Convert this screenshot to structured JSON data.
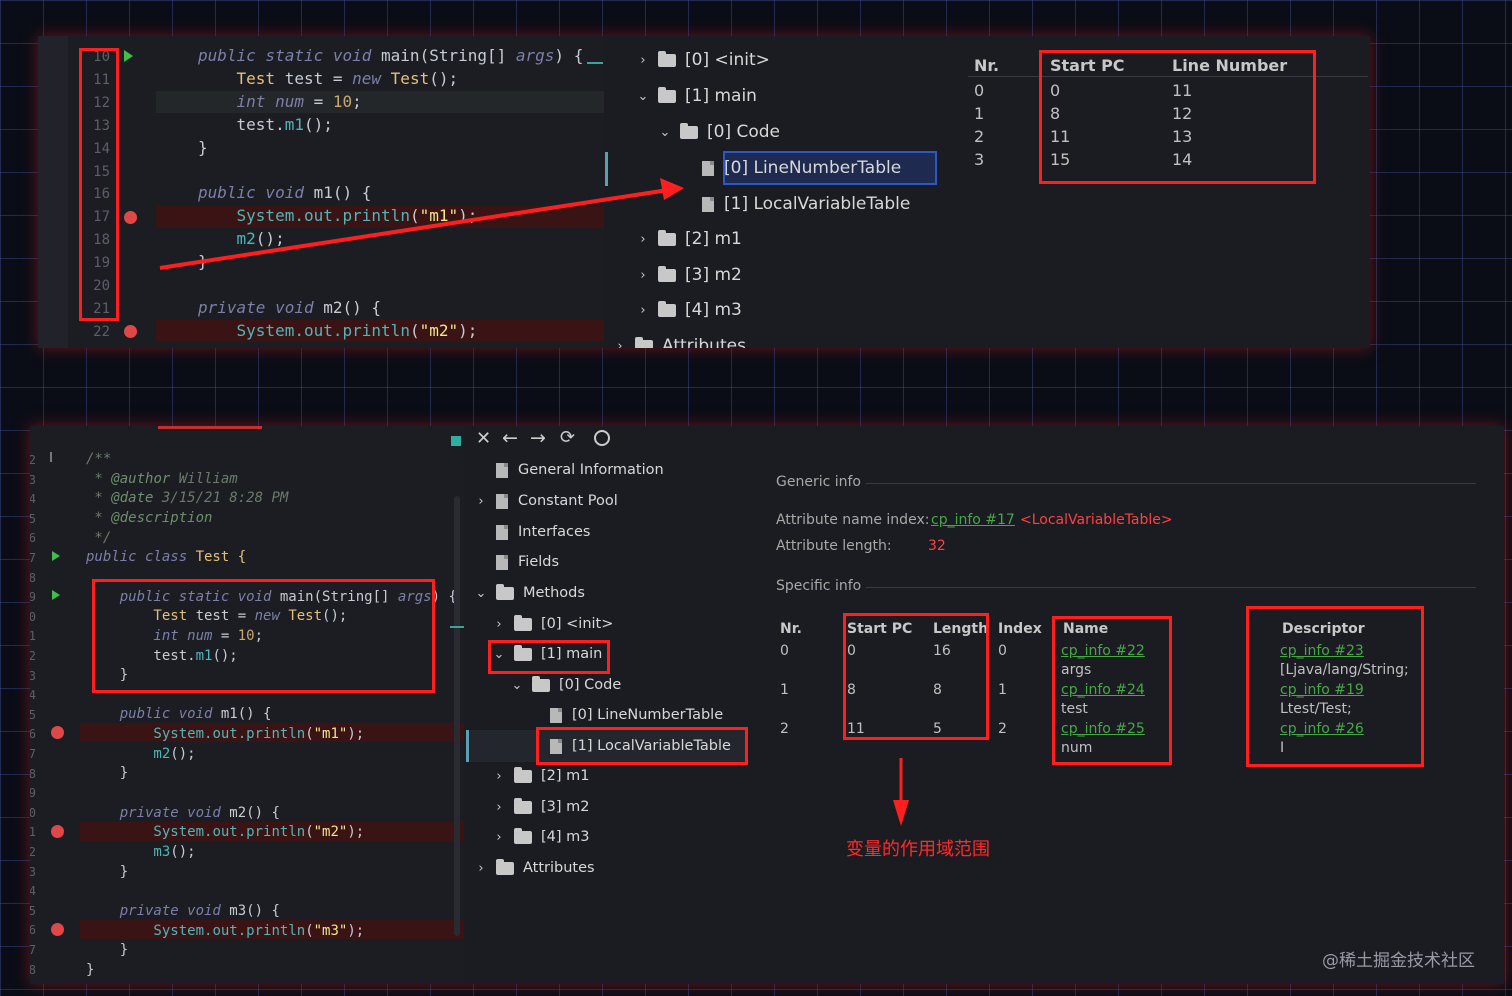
{
  "top_panel": {
    "gutter_lines": [
      "10",
      "11",
      "12",
      "13",
      "14",
      "15",
      "16",
      "17",
      "18",
      "19",
      "20",
      "21",
      "22"
    ],
    "code_lines": [
      {
        "parts": [
          {
            "t": "public static void ",
            "c": "kw"
          },
          {
            "t": "main",
            "c": "fn"
          },
          {
            "t": "(String[] ",
            "c": "fn"
          },
          {
            "t": "args",
            "c": "kw"
          },
          {
            "t": ") {",
            "c": "fn"
          }
        ]
      },
      {
        "parts": [
          {
            "t": "    Test ",
            "c": "cls"
          },
          {
            "t": "test ",
            "c": "fn"
          },
          {
            "t": "= ",
            "c": "fn"
          },
          {
            "t": "new ",
            "c": "kw"
          },
          {
            "t": "Test",
            "c": "cls"
          },
          {
            "t": "();",
            "c": "fn"
          }
        ]
      },
      {
        "parts": [
          {
            "t": "    int ",
            "c": "kw"
          },
          {
            "t": "num ",
            "c": "kw"
          },
          {
            "t": "= ",
            "c": "fn"
          },
          {
            "t": "10",
            "c": "num"
          },
          {
            "t": ";",
            "c": "fn"
          }
        ]
      },
      {
        "parts": [
          {
            "t": "    test.",
            "c": "fn"
          },
          {
            "t": "m1",
            "c": "field"
          },
          {
            "t": "();",
            "c": "fn"
          }
        ]
      },
      {
        "parts": [
          {
            "t": "}",
            "c": "fn"
          }
        ]
      },
      {
        "parts": []
      },
      {
        "parts": [
          {
            "t": "public void ",
            "c": "kw"
          },
          {
            "t": "m1() {",
            "c": "fn"
          }
        ]
      },
      {
        "parts": [
          {
            "t": "    System.",
            "c": "field"
          },
          {
            "t": "out",
            "c": "field"
          },
          {
            "t": ".",
            "c": "field"
          },
          {
            "t": "println",
            "c": "field"
          },
          {
            "t": "(",
            "c": "fn"
          },
          {
            "t": "\"m1\"",
            "c": "str"
          },
          {
            "t": ");",
            "c": "fn"
          }
        ]
      },
      {
        "parts": [
          {
            "t": "    m2",
            "c": "field"
          },
          {
            "t": "();",
            "c": "fn"
          }
        ]
      },
      {
        "parts": [
          {
            "t": "}",
            "c": "fn"
          }
        ]
      },
      {
        "parts": []
      },
      {
        "parts": [
          {
            "t": "private void ",
            "c": "kw"
          },
          {
            "t": "m2() {",
            "c": "fn"
          }
        ]
      },
      {
        "parts": [
          {
            "t": "    System.",
            "c": "field"
          },
          {
            "t": "out",
            "c": "field"
          },
          {
            "t": ".",
            "c": "field"
          },
          {
            "t": "println",
            "c": "field"
          },
          {
            "t": "(",
            "c": "fn"
          },
          {
            "t": "\"m2\"",
            "c": "str"
          },
          {
            "t": ");",
            "c": "fn"
          }
        ]
      }
    ],
    "tree": [
      {
        "label": "[0] <init>",
        "type": "folder",
        "arrow": "›"
      },
      {
        "label": "[1] main",
        "type": "folder",
        "arrow": "⌄"
      },
      {
        "label": "[0] Code",
        "type": "folder",
        "arrow": "⌄"
      },
      {
        "label": "[0] LineNumberTable",
        "type": "file",
        "arrow": ""
      },
      {
        "label": "[1] LocalVariableTable",
        "type": "file",
        "arrow": ""
      },
      {
        "label": "[2] m1",
        "type": "folder",
        "arrow": "›"
      },
      {
        "label": "[3] m2",
        "type": "folder",
        "arrow": "›"
      },
      {
        "label": "[4] m3",
        "type": "folder",
        "arrow": "›"
      },
      {
        "label": "Attributes",
        "type": "folder",
        "arrow": "›"
      }
    ],
    "table": {
      "headers": [
        "Nr.",
        "Start PC",
        "Line Number"
      ],
      "rows": [
        [
          "0",
          "0",
          "11"
        ],
        [
          "1",
          "8",
          "12"
        ],
        [
          "2",
          "11",
          "13"
        ],
        [
          "3",
          "15",
          "14"
        ]
      ]
    }
  },
  "bottom_panel": {
    "gutter_lines": [
      "2",
      "3",
      "4",
      "5",
      "6",
      "7",
      "8",
      "9",
      "0",
      "1",
      "2",
      "3",
      "4",
      "5",
      "6",
      "7",
      "8",
      "9",
      "0",
      "1",
      "2",
      "3",
      "4",
      "5",
      "6",
      "7",
      "8",
      "9"
    ],
    "code_lines": [
      {
        "parts": [
          {
            "t": "/**",
            "c": "cmt"
          }
        ]
      },
      {
        "parts": [
          {
            "t": " * ",
            "c": "cmt"
          },
          {
            "t": "@author ",
            "c": "tag"
          },
          {
            "t": "William",
            "c": "cmt"
          }
        ]
      },
      {
        "parts": [
          {
            "t": " * ",
            "c": "cmt"
          },
          {
            "t": "@date ",
            "c": "tag"
          },
          {
            "t": "3/15/21 8:28 PM",
            "c": "cmt"
          }
        ]
      },
      {
        "parts": [
          {
            "t": " * ",
            "c": "cmt"
          },
          {
            "t": "@description",
            "c": "tag"
          }
        ]
      },
      {
        "parts": [
          {
            "t": " */",
            "c": "cmt"
          }
        ]
      },
      {
        "parts": [
          {
            "t": "public class ",
            "c": "kw"
          },
          {
            "t": "Test {",
            "c": "cls"
          }
        ]
      },
      {
        "parts": []
      },
      {
        "parts": [
          {
            "t": "    public static void ",
            "c": "kw"
          },
          {
            "t": "main",
            "c": "fn"
          },
          {
            "t": "(String[] ",
            "c": "fn"
          },
          {
            "t": "args",
            "c": "kw"
          },
          {
            "t": ") {",
            "c": "fn"
          }
        ]
      },
      {
        "parts": [
          {
            "t": "        Test ",
            "c": "cls"
          },
          {
            "t": "test ",
            "c": "fn"
          },
          {
            "t": "= ",
            "c": "fn"
          },
          {
            "t": "new ",
            "c": "kw"
          },
          {
            "t": "Test",
            "c": "cls"
          },
          {
            "t": "();",
            "c": "fn"
          }
        ]
      },
      {
        "parts": [
          {
            "t": "        int ",
            "c": "kw"
          },
          {
            "t": "num ",
            "c": "kw"
          },
          {
            "t": "= ",
            "c": "fn"
          },
          {
            "t": "10",
            "c": "num"
          },
          {
            "t": ";",
            "c": "fn"
          }
        ]
      },
      {
        "parts": [
          {
            "t": "        test.",
            "c": "fn"
          },
          {
            "t": "m1",
            "c": "field"
          },
          {
            "t": "();",
            "c": "fn"
          }
        ]
      },
      {
        "parts": [
          {
            "t": "    }",
            "c": "fn"
          }
        ]
      },
      {
        "parts": []
      },
      {
        "parts": [
          {
            "t": "    public void ",
            "c": "kw"
          },
          {
            "t": "m1() {",
            "c": "fn"
          }
        ]
      },
      {
        "parts": [
          {
            "t": "        System.",
            "c": "field"
          },
          {
            "t": "out",
            "c": "field"
          },
          {
            "t": ".",
            "c": "field"
          },
          {
            "t": "println",
            "c": "field"
          },
          {
            "t": "(",
            "c": "fn"
          },
          {
            "t": "\"m1\"",
            "c": "str"
          },
          {
            "t": ");",
            "c": "fn"
          }
        ]
      },
      {
        "parts": [
          {
            "t": "        m2",
            "c": "field"
          },
          {
            "t": "();",
            "c": "fn"
          }
        ]
      },
      {
        "parts": [
          {
            "t": "    }",
            "c": "fn"
          }
        ]
      },
      {
        "parts": []
      },
      {
        "parts": [
          {
            "t": "    private void ",
            "c": "kw"
          },
          {
            "t": "m2() {",
            "c": "fn"
          }
        ]
      },
      {
        "parts": [
          {
            "t": "        System.",
            "c": "field"
          },
          {
            "t": "out",
            "c": "field"
          },
          {
            "t": ".",
            "c": "field"
          },
          {
            "t": "println",
            "c": "field"
          },
          {
            "t": "(",
            "c": "fn"
          },
          {
            "t": "\"m2\"",
            "c": "str"
          },
          {
            "t": ");",
            "c": "fn"
          }
        ]
      },
      {
        "parts": [
          {
            "t": "        m3",
            "c": "field"
          },
          {
            "t": "();",
            "c": "fn"
          }
        ]
      },
      {
        "parts": [
          {
            "t": "    }",
            "c": "fn"
          }
        ]
      },
      {
        "parts": []
      },
      {
        "parts": [
          {
            "t": "    private void ",
            "c": "kw"
          },
          {
            "t": "m3() {",
            "c": "fn"
          }
        ]
      },
      {
        "parts": [
          {
            "t": "        System.",
            "c": "field"
          },
          {
            "t": "out",
            "c": "field"
          },
          {
            "t": ".",
            "c": "field"
          },
          {
            "t": "println",
            "c": "field"
          },
          {
            "t": "(",
            "c": "fn"
          },
          {
            "t": "\"m3\"",
            "c": "str"
          },
          {
            "t": ");",
            "c": "fn"
          }
        ]
      },
      {
        "parts": [
          {
            "t": "    }",
            "c": "fn"
          }
        ]
      },
      {
        "parts": [
          {
            "t": "}",
            "c": "fn"
          }
        ]
      }
    ],
    "toolbar_icons": [
      "close-icon",
      "back-arrow-icon",
      "forward-arrow-icon",
      "refresh-icon",
      "globe-icon"
    ],
    "tree": [
      {
        "label": "General Information",
        "type": "file",
        "arrow": ""
      },
      {
        "label": "Constant Pool",
        "type": "file",
        "arrow": "›"
      },
      {
        "label": "Interfaces",
        "type": "file",
        "arrow": ""
      },
      {
        "label": "Fields",
        "type": "file",
        "arrow": ""
      },
      {
        "label": "Methods",
        "type": "folder",
        "arrow": "⌄"
      },
      {
        "label": "[0] <init>",
        "type": "folder",
        "arrow": "›"
      },
      {
        "label": "[1] main",
        "type": "folder",
        "arrow": "⌄"
      },
      {
        "label": "[0] Code",
        "type": "folder",
        "arrow": "⌄"
      },
      {
        "label": "[0] LineNumberTable",
        "type": "file",
        "arrow": ""
      },
      {
        "label": "[1] LocalVariableTable",
        "type": "file",
        "arrow": ""
      },
      {
        "label": "[2] m1",
        "type": "folder",
        "arrow": "›"
      },
      {
        "label": "[3] m2",
        "type": "folder",
        "arrow": "›"
      },
      {
        "label": "[4] m3",
        "type": "folder",
        "arrow": "›"
      },
      {
        "label": "Attributes",
        "type": "folder",
        "arrow": "›"
      }
    ],
    "generic_info_title": "Generic info",
    "attr_name_label": "Attribute name index:",
    "attr_name_link": "cp_info #17",
    "attr_name_value": "<LocalVariableTable>",
    "attr_length_label": "Attribute length:",
    "attr_length_value": "32",
    "specific_info_title": "Specific info",
    "table_headers": {
      "nr": "Nr.",
      "start": "Start PC",
      "length": "Length",
      "index": "Index",
      "name": "Name",
      "descriptor": "Descriptor"
    },
    "rows": [
      {
        "nr": "0",
        "start": "0",
        "length": "16",
        "index": "0",
        "name_link": "cp_info #22",
        "name": "args",
        "desc_link": "cp_info #23",
        "desc": "[Ljava/lang/String;"
      },
      {
        "nr": "1",
        "start": "8",
        "length": "8",
        "index": "1",
        "name_link": "cp_info #24",
        "name": "test",
        "desc_link": "cp_info #19",
        "desc": "Ltest/Test;"
      },
      {
        "nr": "2",
        "start": "11",
        "length": "5",
        "index": "2",
        "name_link": "cp_info #25",
        "name": "num",
        "desc_link": "cp_info #26",
        "desc": "I"
      }
    ],
    "annotation": "变量的作用域范围"
  },
  "watermark": "@稀土掘金技术社区",
  "colors": {
    "highlight_red": "#ff1f1f",
    "link_green": "#45a845",
    "value_red": "#ff4040"
  }
}
